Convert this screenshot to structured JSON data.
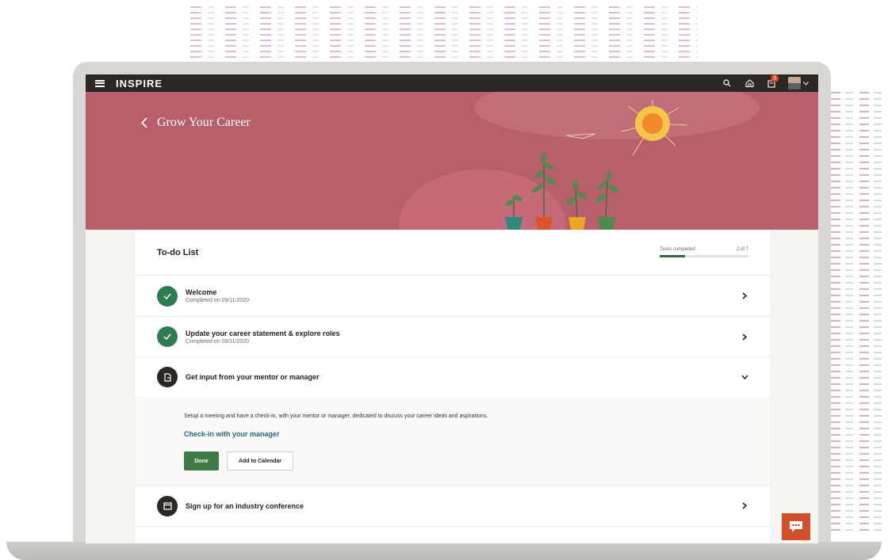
{
  "app": {
    "brand": "INSPIRE"
  },
  "topbar": {
    "icons": [
      "hamburger-menu-icon",
      "search-icon",
      "home-icon",
      "notifications-icon",
      "user-avatar",
      "chevron-down-icon"
    ],
    "notification_count": "3"
  },
  "hero": {
    "title": "Grow Your Career"
  },
  "todo": {
    "title": "To-do List",
    "progress_label": "Tasks completed",
    "progress_count": "2 of 7",
    "progress_fraction": 0.29
  },
  "tasks": [
    {
      "title": "Welcome",
      "status": "Completed on 09/11/2020",
      "icon": "check-icon",
      "state": "done"
    },
    {
      "title": "Update your career statement & explore roles",
      "status": "Completed on 09/11/2020",
      "icon": "check-icon",
      "state": "done"
    },
    {
      "title": "Get input from your mentor or manager",
      "icon": "document-icon",
      "state": "expanded"
    },
    {
      "title": "Sign up for an industry conference",
      "icon": "calendar-icon",
      "state": "collapsed"
    }
  ],
  "expanded_task": {
    "description": "Setup a meeting and have a check-in, with your mentor or manager, dedicated to discuss your career ideas and aspirations.",
    "link": "Check-in with your manager",
    "done_button": "Done",
    "calendar_button": "Add to Calendar"
  },
  "colors": {
    "appbar": "#2b2724",
    "hero": "#b85f6c",
    "success": "#2e7d51",
    "link": "#1d6b80",
    "primary_button": "#3f7a47",
    "chat": "#d14f2a"
  }
}
